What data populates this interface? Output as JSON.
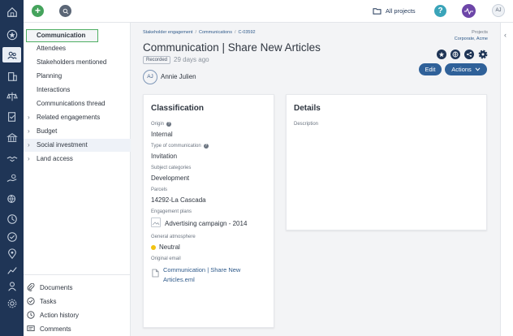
{
  "topbar": {
    "add_label": "+",
    "all_projects_label": "All projects",
    "help_label": "?",
    "user_initials": "AJ"
  },
  "sidenav": {
    "items": [
      {
        "label": "Communication",
        "state": "selected"
      },
      {
        "label": "Attendees"
      },
      {
        "label": "Stakeholders mentioned"
      },
      {
        "label": "Planning"
      },
      {
        "label": "Interactions"
      },
      {
        "label": "Communications thread"
      },
      {
        "label": "Related engagements",
        "expandable": true
      },
      {
        "label": "Budget",
        "expandable": true
      },
      {
        "label": "Social investment",
        "expandable": true,
        "state": "highlighted"
      },
      {
        "label": "Land access",
        "expandable": true
      }
    ],
    "bottom": [
      {
        "label": "Documents",
        "icon": "paperclip-icon"
      },
      {
        "label": "Tasks",
        "icon": "check-circle-icon"
      },
      {
        "label": "Action history",
        "icon": "history-icon"
      },
      {
        "label": "Comments",
        "icon": "comment-icon"
      }
    ]
  },
  "header": {
    "breadcrumb": [
      "Stakeholder engagement",
      "Communications",
      "C-03592"
    ],
    "projects_label": "Projects",
    "projects_value": "Corporate, Acme",
    "title": "Communication | Share New Articles",
    "status_badge": "Recorded",
    "status_time": "29 days ago",
    "owner_initials": "AJ",
    "owner_name": "Annie Julien",
    "edit_label": "Edit",
    "actions_label": "Actions"
  },
  "classification": {
    "title": "Classification",
    "origin_label": "Origin",
    "origin_value": "Internal",
    "type_label": "Type of communication",
    "type_value": "Invitation",
    "subject_label": "Subject categories",
    "subject_value": "Development",
    "parcels_label": "Parcels",
    "parcels_value": "14292-La Cascada",
    "plans_label": "Engagement plans",
    "plans_value": "Advertising campaign - 2014",
    "atmosphere_label": "General atmosphere",
    "atmosphere_value": "Neutral",
    "atmosphere_color": "#f2c312",
    "email_label": "Original email",
    "email_value": "Communication | Share New Articles.eml"
  },
  "details": {
    "title": "Details",
    "description_label": "Description"
  },
  "colors": {
    "rail": "#1f3556",
    "primary_button": "#2f6199",
    "add_button": "#45a35c",
    "help_button": "#3aa4b9",
    "pulse_button": "#6d46a8",
    "selected_border": "#4fae63"
  }
}
